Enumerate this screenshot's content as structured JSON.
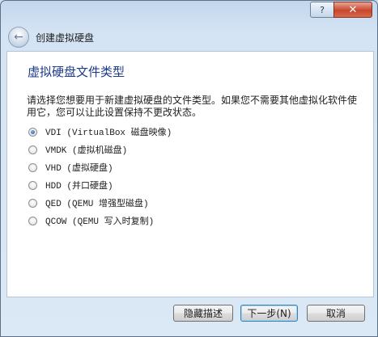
{
  "titlebar": {
    "help_label": "?",
    "close_label": "✕"
  },
  "nav": {
    "back_icon": "back-arrow-icon",
    "back_glyph": "←",
    "title": "创建虚拟硬盘"
  },
  "main": {
    "heading": "虚拟硬盘文件类型",
    "description": "请选择您想要用于新建虚拟硬盘的文件类型。如果您不需要其他虚拟化软件使用它，您可以让此设置保持不更改状态。",
    "options": [
      {
        "label": "VDI (VirtualBox 磁盘映像)",
        "checked": true
      },
      {
        "label": "VMDK (虚拟机磁盘)",
        "checked": false
      },
      {
        "label": "VHD (虚拟硬盘)",
        "checked": false
      },
      {
        "label": "HDD (并口硬盘)",
        "checked": false
      },
      {
        "label": "QED (QEMU 增强型磁盘)",
        "checked": false
      },
      {
        "label": "QCOW (QEMU 写入时复制)",
        "checked": false
      }
    ]
  },
  "footer": {
    "hide_label": "隐藏描述",
    "next_label": "下一步(N)",
    "cancel_label": "取消"
  }
}
